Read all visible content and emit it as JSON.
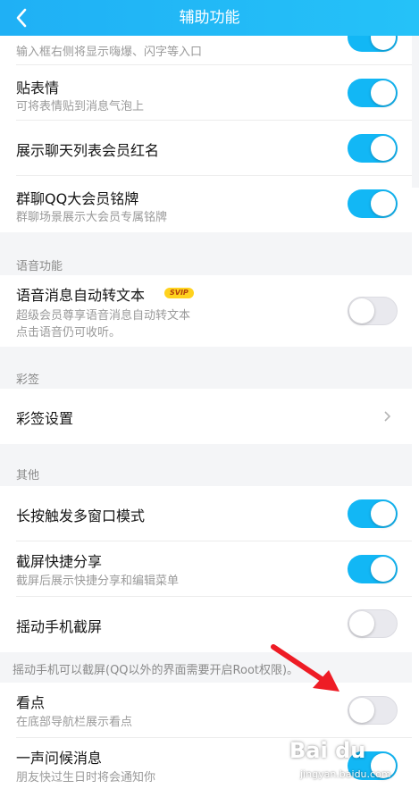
{
  "header": {
    "title": "辅助功能"
  },
  "rows": {
    "entry": {
      "sub": "输入框右侧将显示嗨爆、闪字等入口",
      "toggle": "on"
    },
    "sticker": {
      "title": "贴表情",
      "sub": "可将表情贴到消息气泡上",
      "toggle": "on"
    },
    "vip_red": {
      "title": "展示聊天列表会员红名",
      "toggle": "on"
    },
    "group_badge": {
      "title": "群聊QQ大会员铭牌",
      "sub": "群聊场景展示大会员专属铭牌",
      "toggle": "on"
    },
    "voice_to_text": {
      "title": "语音消息自动转文本",
      "badge": "SVIP",
      "sub1": "超级会员尊享语音消息自动转文本",
      "sub2": "点击语音仍可收听。",
      "toggle": "off"
    },
    "caiqian_settings": {
      "title": "彩签设置"
    },
    "long_press": {
      "title": "长按触发多窗口模式",
      "toggle": "on"
    },
    "screenshot_share": {
      "title": "截屏快捷分享",
      "sub": "截屏后展示快捷分享和编辑菜单",
      "toggle": "on"
    },
    "shake_screenshot": {
      "title": "摇动手机截屏",
      "toggle": "off"
    },
    "kandian": {
      "title": "看点",
      "sub": "在底部导航栏展示看点",
      "toggle": "off"
    },
    "greeting": {
      "title": "一声问候消息",
      "sub": "朋友快过生日时将会通知你",
      "toggle": "on"
    }
  },
  "sections": {
    "voice": "语音功能",
    "caiqian": "彩签",
    "other": "其他",
    "shake_note": "摇动手机可以截屏(QQ以外的界面需要开启Root权限)。"
  },
  "watermark": {
    "brand": "Bai du",
    "sub": "jingyan.baidu.com"
  },
  "colors": {
    "accent": "#12b7f5",
    "header": "#1fb0f5",
    "arrow": "#ee1c25"
  }
}
